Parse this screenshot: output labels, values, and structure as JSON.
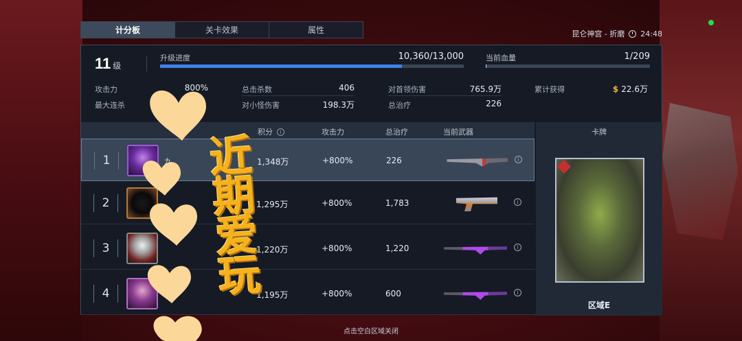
{
  "tabs": [
    {
      "label": "计分板",
      "active": true
    },
    {
      "label": "关卡效果",
      "active": false
    },
    {
      "label": "属性",
      "active": false
    }
  ],
  "top_right": {
    "location": "昆仑神宫 - 折磨",
    "time": "24:48"
  },
  "header": {
    "level_value": "11",
    "level_unit": "级",
    "progress_label": "升级进度",
    "progress_value": "10,360/13,000",
    "progress_fraction": 0.797,
    "hp_label": "当前血量",
    "hp_value": "1/209",
    "hp_fraction": 0.005
  },
  "stats": {
    "attack_label": "攻击力",
    "attack_value": "800%",
    "max_combo_label": "最大连杀",
    "total_kills_label": "总击杀数",
    "total_kills_value": "406",
    "minion_damage_label": "对小怪伤害",
    "minion_damage_value": "198.3万",
    "boss_damage_label": "对首领伤害",
    "boss_damage_value": "765.9万",
    "total_heal_label": "总治疗",
    "total_heal_value": "226",
    "earned_label": "累计获得",
    "earned_value": "22.6万",
    "earned_icon": "dollar-icon"
  },
  "table": {
    "headers": {
      "score": "积分",
      "attack": "攻击力",
      "heal": "总治疗",
      "weapon": "当前武器",
      "card": "卡牌"
    },
    "rows": [
      {
        "rank": "1",
        "name": "九",
        "score": "1,348万",
        "attack": "+800%",
        "heal": "226",
        "weapon": "rifle-icon"
      },
      {
        "rank": "2",
        "name": "",
        "score": "1,295万",
        "attack": "+800%",
        "heal": "1,783",
        "weapon": "pistol-icon"
      },
      {
        "rank": "3",
        "name": "",
        "score": "1,220万",
        "attack": "+800%",
        "heal": "1,220",
        "weapon": "sniper-icon"
      },
      {
        "rank": "4",
        "name": "",
        "score": "1,195万",
        "attack": "+800%",
        "heal": "600",
        "weapon": "sniper-icon"
      }
    ],
    "card_name": "区域E"
  },
  "footer": {
    "hint": "点击空白区域关闭"
  },
  "overlay": {
    "text": "近期爱玩"
  },
  "colors": {
    "accent": "#3f82e6",
    "money": "#e8b23a",
    "sticker": "#f6b21c",
    "status": "#22dd55"
  }
}
